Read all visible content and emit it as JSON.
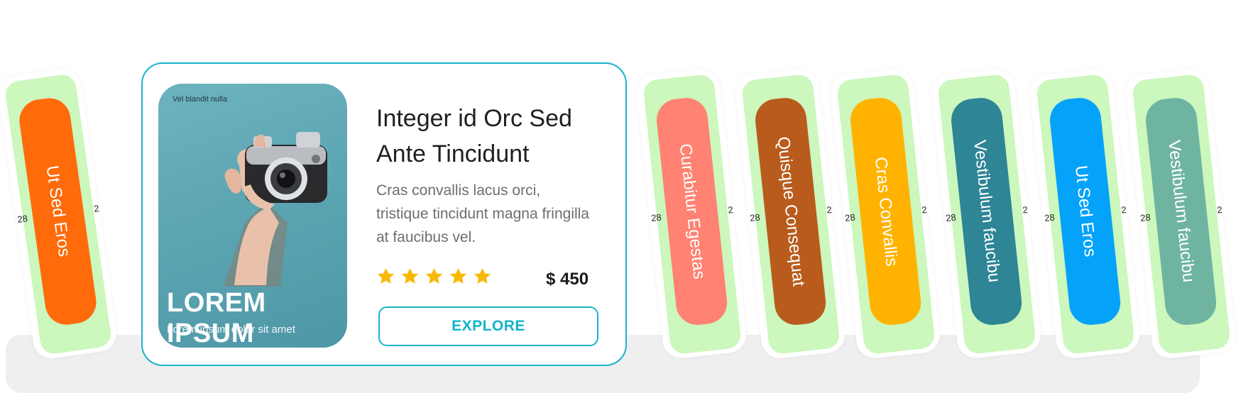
{
  "featured": {
    "cover_tag": "Vel blandit nulla",
    "cover_title": "LOREM IPSUM",
    "cover_subtitle": "Lorem ipsum dolor sit amet",
    "title": "Integer id Orc Sed Ante Tincidunt",
    "description": "Cras convallis lacus orci, tristique tincidunt magna fringilla at faucibus vel.",
    "rating": 5,
    "rating_max": 5,
    "star_color": "#f8b905",
    "price": "$ 450",
    "cta_label": "EXPLORE",
    "accent": "#19b3cc"
  },
  "mini_cards": [
    {
      "label": "Ut Sed Eros",
      "color": "#ff6a0b"
    },
    {
      "label": "Curabitur Egestas",
      "color": "#ff8272"
    },
    {
      "label": "Quisque Consequat",
      "color": "#b85b1c"
    },
    {
      "label": "Cras Convallis",
      "color": "#ffb300"
    },
    {
      "label": "Vestibulum faucibu",
      "color": "#2d8596"
    },
    {
      "label": "Ut Sed Eros",
      "color": "#04a3f9"
    },
    {
      "label": "Vestibulum faucibu",
      "color": "#6fb4a1"
    }
  ],
  "mat_color": "#ccf7bd"
}
